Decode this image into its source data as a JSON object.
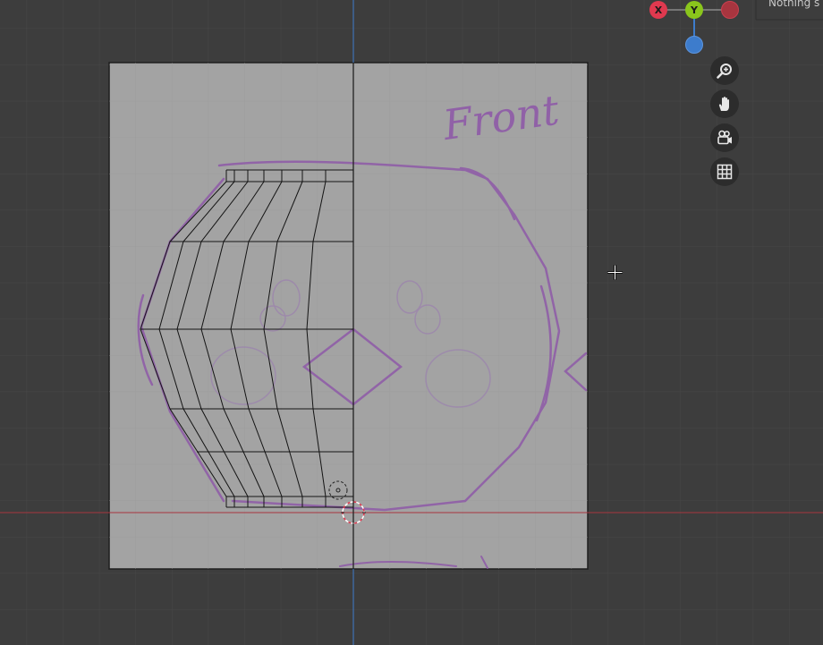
{
  "status": {
    "text": "Nothing s"
  },
  "gizmo": {
    "x_label": "X",
    "y_label": "Y",
    "colors": {
      "x": "#e0394f",
      "y": "#8ac61c",
      "z": "#3d7ccc",
      "x_neg": "#a8353f"
    }
  },
  "tools": [
    {
      "name": "zoom-icon",
      "tooltip": ""
    },
    {
      "name": "hand-pan-icon",
      "tooltip": ""
    },
    {
      "name": "camera-view-icon",
      "tooltip": ""
    },
    {
      "name": "grid-perspective-icon",
      "tooltip": ""
    }
  ],
  "reference": {
    "annotation_text": "Front",
    "sketch_color": "#8e5aa8"
  },
  "colors": {
    "background": "#3d3d3d",
    "grid_line": "#474747",
    "x_axis": "#a8353f",
    "y_axis": "#3d7ccc"
  }
}
